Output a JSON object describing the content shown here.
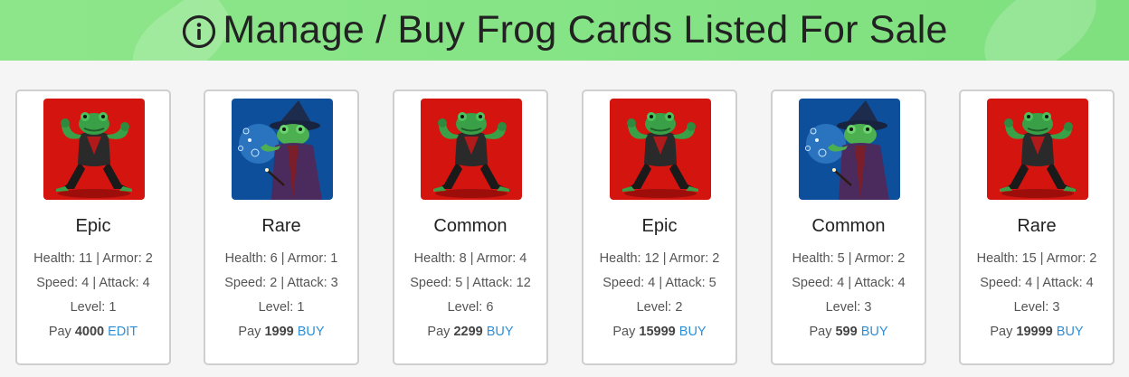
{
  "header": {
    "title": "Manage / Buy Frog Cards Listed For Sale"
  },
  "colors": {
    "banner": "#86e486",
    "link": "#2f8fd6",
    "warrior_bg": "#d3140f",
    "wizard_bg": "#0e4f9c"
  },
  "labels": {
    "health": "Health",
    "armor": "Armor",
    "speed": "Speed",
    "attack": "Attack",
    "level": "Level",
    "pay": "Pay"
  },
  "cards": [
    {
      "art": "warrior-frog",
      "rarity": "Epic",
      "stats1": "Health: 11 | Armor: 2",
      "stats2": "Speed: 4 | Attack: 4",
      "level": "Level: 1",
      "pay_label": "Pay",
      "price": "4000",
      "action": "EDIT"
    },
    {
      "art": "wizard-frog",
      "rarity": "Rare",
      "stats1": "Health: 6 | Armor: 1",
      "stats2": "Speed: 2 | Attack: 3",
      "level": "Level: 1",
      "pay_label": "Pay",
      "price": "1999",
      "action": "BUY"
    },
    {
      "art": "warrior-frog",
      "rarity": "Common",
      "stats1": "Health: 8 | Armor: 4",
      "stats2": "Speed: 5 | Attack: 12",
      "level": "Level: 6",
      "pay_label": "Pay",
      "price": "2299",
      "action": "BUY"
    },
    {
      "art": "warrior-frog",
      "rarity": "Epic",
      "stats1": "Health: 12 | Armor: 2",
      "stats2": "Speed: 4 | Attack: 5",
      "level": "Level: 2",
      "pay_label": "Pay",
      "price": "15999",
      "action": "BUY"
    },
    {
      "art": "wizard-frog",
      "rarity": "Common",
      "stats1": "Health: 5 | Armor: 2",
      "stats2": "Speed: 4 | Attack: 4",
      "level": "Level: 3",
      "pay_label": "Pay",
      "price": "599",
      "action": "BUY"
    },
    {
      "art": "warrior-frog",
      "rarity": "Rare",
      "stats1": "Health: 15 | Armor: 2",
      "stats2": "Speed: 4 | Attack: 4",
      "level": "Level: 3",
      "pay_label": "Pay",
      "price": "19999",
      "action": "BUY"
    }
  ]
}
